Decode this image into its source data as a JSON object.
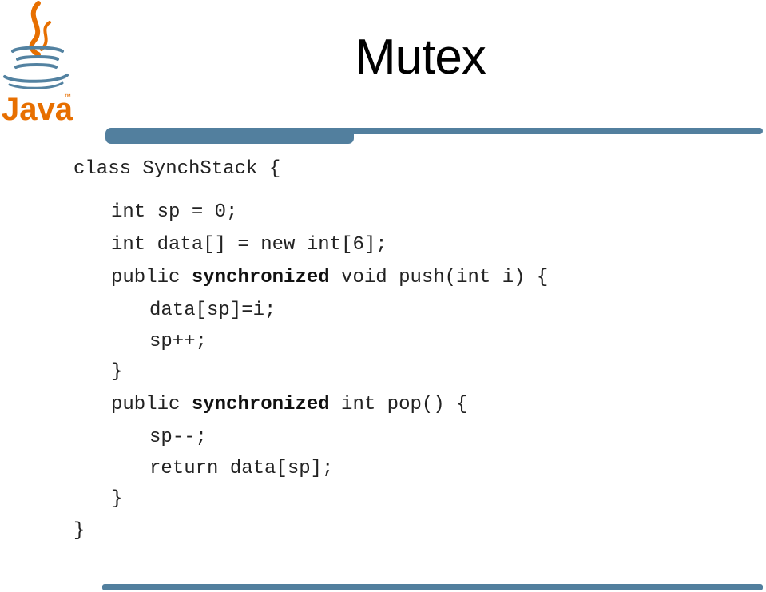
{
  "slide": {
    "title": "Mutex",
    "logo": {
      "name": "java-logo",
      "text": "Java",
      "tm": "™",
      "colors": {
        "orange": "#e76f00",
        "blue": "#5382a1"
      }
    },
    "accent_color": "#527f9e"
  },
  "code": {
    "language": "java",
    "lines": [
      {
        "indent": 0,
        "parts": [
          "class SynchStack {"
        ]
      },
      {
        "indent": 1,
        "parts": [
          "int sp = 0;"
        ]
      },
      {
        "indent": 1,
        "parts": [
          "int data[] = new int[6];"
        ]
      },
      {
        "indent": 1,
        "parts": [
          "public ",
          "synchronized",
          " void push(int i) {"
        ]
      },
      {
        "indent": 2,
        "parts": [
          "data[sp]=i;"
        ]
      },
      {
        "indent": 2,
        "parts": [
          "sp++;"
        ]
      },
      {
        "indent": 1,
        "parts": [
          "}"
        ]
      },
      {
        "indent": 1,
        "parts": [
          "public ",
          "synchronized",
          " int pop() {"
        ]
      },
      {
        "indent": 2,
        "parts": [
          "sp--;"
        ]
      },
      {
        "indent": 2,
        "parts": [
          "return data[sp];"
        ]
      },
      {
        "indent": 1,
        "parts": [
          "}"
        ]
      },
      {
        "indent": 0,
        "parts": [
          "}"
        ]
      }
    ]
  }
}
